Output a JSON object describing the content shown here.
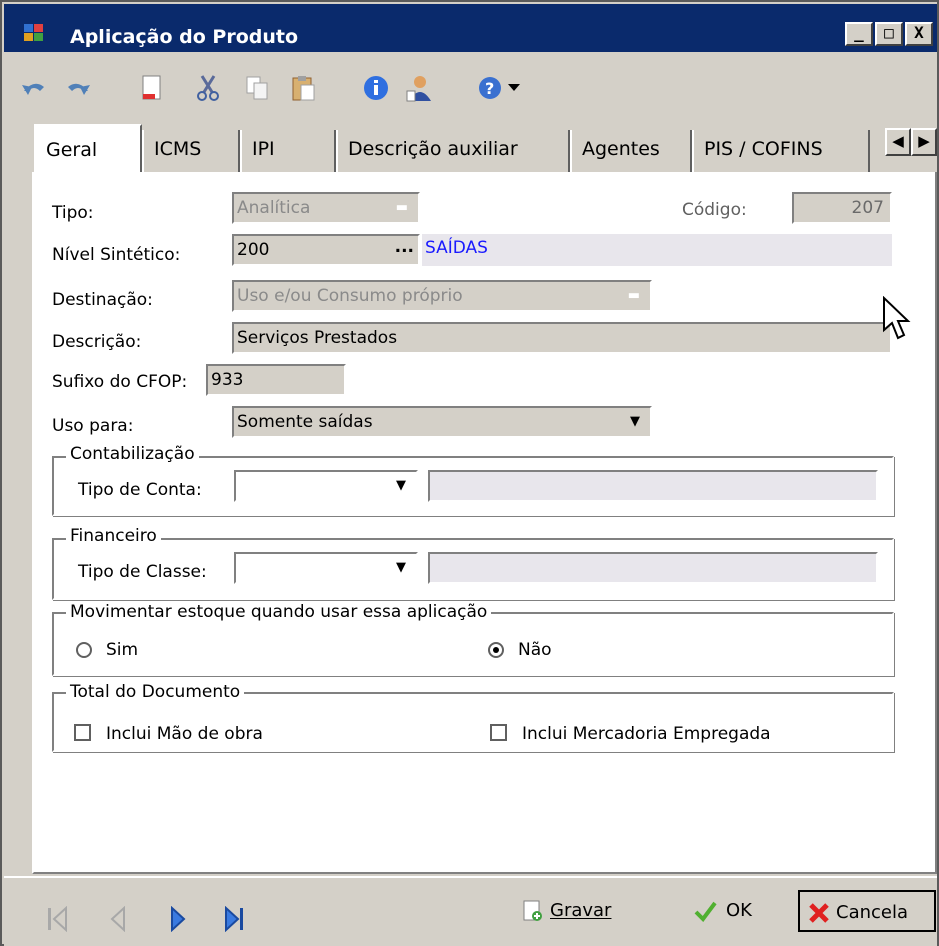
{
  "window": {
    "title": "Aplicação do Produto",
    "controls": [
      "_",
      "□",
      "X"
    ]
  },
  "toolbar": {
    "icons": [
      "undo-icon",
      "redo-icon",
      "new-document-icon",
      "cut-icon",
      "copy-icon",
      "paste-icon",
      "info-icon",
      "user-icon",
      "help-icon",
      "dropdown-arrow-icon"
    ]
  },
  "tabs": [
    {
      "label": "Geral",
      "active": true
    },
    {
      "label": "ICMS"
    },
    {
      "label": "IPI"
    },
    {
      "label": "Descrição auxiliar"
    },
    {
      "label": "Agentes"
    },
    {
      "label": "PIS / COFINS"
    }
  ],
  "form": {
    "tipo_label": "Tipo:",
    "tipo_value": "Analítica",
    "codigo_label": "Código:",
    "codigo_value": "207",
    "nivel_label": "Nível Sintético:",
    "nivel_value": "200",
    "nivel_ellipsis": "...",
    "nivel_desc": "SAÍDAS",
    "destinacao_label": "Destinação:",
    "destinacao_value": "Uso e/ou Consumo próprio",
    "descricao_label": "Descrição:",
    "descricao_value": "Serviços Prestados",
    "sufixo_label": "Sufixo do CFOP:",
    "sufixo_value": "933",
    "uso_label": "Uso para:",
    "uso_value": "Somente saídas"
  },
  "contabilizacao": {
    "title": "Contabilização",
    "tipo_conta_label": "Tipo de Conta:"
  },
  "financeiro": {
    "title": "Financeiro",
    "tipo_classe_label": "Tipo de Classe:"
  },
  "estoque": {
    "title": "Movimentar estoque quando usar essa aplicação",
    "sim_label": "Sim",
    "nao_label": "Não",
    "selected": "Não"
  },
  "total": {
    "title": "Total do Documento",
    "mao_obra_label": "Inclui Mão de obra",
    "mercadoria_label": "Inclui Mercadoria Empregada"
  },
  "buttons": {
    "gravar": "Gravar",
    "ok": "OK",
    "cancela": "Cancela"
  },
  "colors": {
    "titlebar": "#0a2a6c",
    "link_blue": "#1a1aff",
    "window_bg": "#d4d0c8"
  }
}
